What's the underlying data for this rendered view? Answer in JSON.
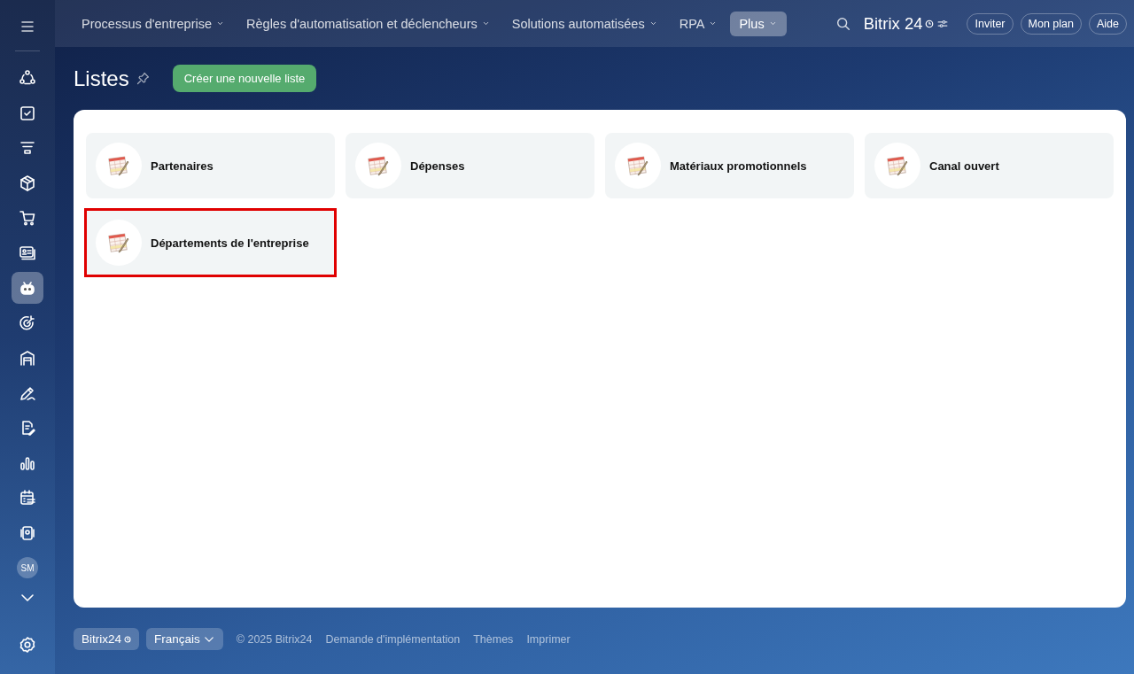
{
  "top_nav": {
    "items": [
      {
        "label": "Processus d'entreprise",
        "selected": false
      },
      {
        "label": "Règles d'automatisation et déclencheurs",
        "selected": false
      },
      {
        "label": "Solutions automatisées",
        "selected": false
      },
      {
        "label": "RPA",
        "selected": false
      },
      {
        "label": "Plus",
        "selected": true
      }
    ],
    "logo": "Bitrix 24",
    "buttons": [
      "Inviter",
      "Mon plan",
      "Aide"
    ]
  },
  "sidebar": {
    "items": [
      {
        "selected": false
      },
      {
        "selected": false
      },
      {
        "selected": false
      },
      {
        "selected": false
      },
      {
        "selected": false
      },
      {
        "selected": false
      },
      {
        "selected": true
      },
      {
        "selected": false
      },
      {
        "selected": false
      },
      {
        "selected": false
      },
      {
        "selected": false
      },
      {
        "selected": false
      },
      {
        "selected": false
      },
      {
        "selected": false
      }
    ],
    "avatar": "SM"
  },
  "page": {
    "title": "Listes",
    "create_button": "Créer une nouvelle liste"
  },
  "lists": [
    {
      "name": "Partenaires",
      "highlighted": false
    },
    {
      "name": "Dépenses",
      "highlighted": false
    },
    {
      "name": "Matériaux promotionnels",
      "highlighted": false
    },
    {
      "name": "Canal ouvert",
      "highlighted": false
    },
    {
      "name": "Départements de l'entreprise",
      "highlighted": true
    }
  ],
  "footer": {
    "brand": "Bitrix24",
    "language": "Français",
    "copyright": "© 2025 Bitrix24",
    "links": [
      "Demande d'implémentation",
      "Thèmes",
      "Imprimer"
    ]
  }
}
